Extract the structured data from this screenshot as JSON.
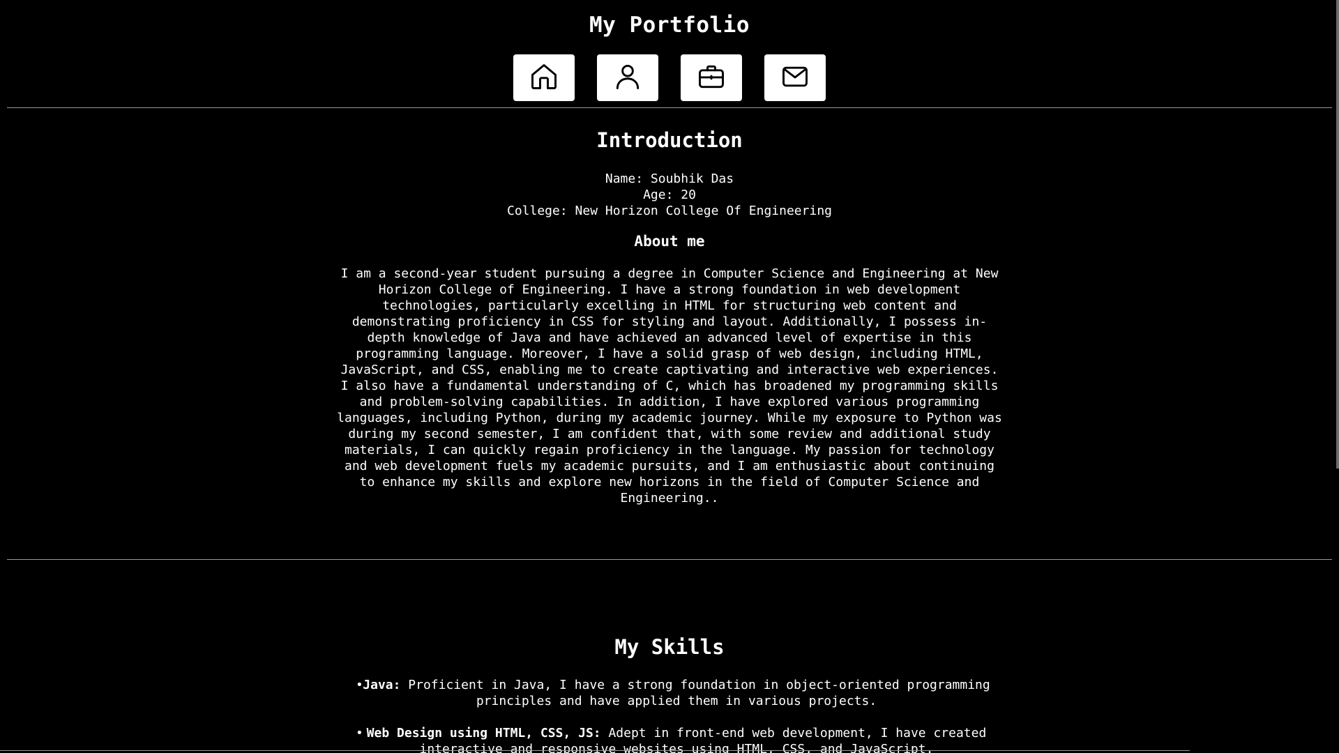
{
  "header": {
    "title": "My Portfolio"
  },
  "nav": [
    {
      "icon": "home-icon",
      "label": "Home"
    },
    {
      "icon": "user-icon",
      "label": "About"
    },
    {
      "icon": "briefcase-icon",
      "label": "Projects"
    },
    {
      "icon": "mail-icon",
      "label": "Contact"
    }
  ],
  "intro": {
    "title": "Introduction",
    "name": "Name: Soubhik Das",
    "age": "Age: 20",
    "college": "College: New Horizon College Of Engineering",
    "about_title": "About me",
    "about_text": "I am a second-year student pursuing a degree in Computer Science and Engineering at New Horizon College of Engineering. I have a strong foundation in web development technologies, particularly excelling in HTML for structuring web content and demonstrating proficiency in CSS for styling and layout. Additionally, I possess in-depth knowledge of Java and have achieved an advanced level of expertise in this programming language. Moreover, I have a solid grasp of web design, including HTML, JavaScript, and CSS, enabling me to create captivating and interactive web experiences. I also have a fundamental understanding of C, which has broadened my programming skills and problem-solving capabilities. In addition, I have explored various programming languages, including Python, during my academic journey. While my exposure to Python was during my second semester, I am confident that, with some review and additional study materials, I can quickly regain proficiency in the language. My passion for technology and web development fuels my academic pursuits, and I am enthusiastic about continuing to enhance my skills and explore new horizons in the field of Computer Science and Engineering.."
  },
  "skills": {
    "title": "My Skills",
    "items": [
      {
        "name": "Java:",
        "text": " Proficient in Java, I have a strong foundation in object-oriented programming principles and have applied them in various projects."
      },
      {
        "name": "Web Design using HTML, CSS, JS:",
        "text": " Adept in front-end web development, I have created interactive and responsive websites using HTML, CSS, and JavaScript."
      }
    ]
  },
  "colors": {
    "background": "#000000",
    "text": "#ffffff",
    "nav_button": "#ffffff",
    "divider": "#9a9a9a"
  }
}
